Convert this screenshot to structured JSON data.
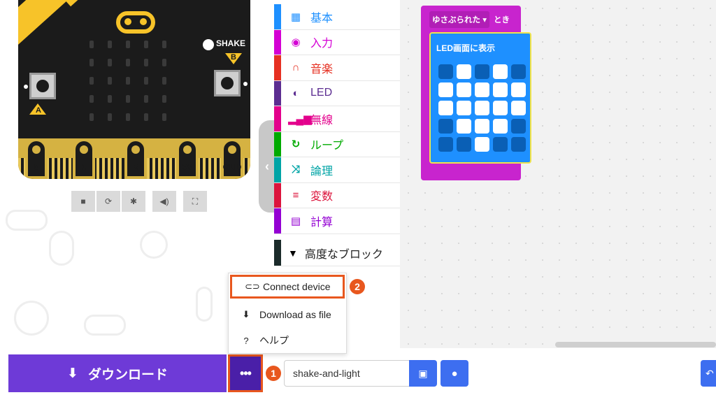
{
  "simulator": {
    "shake_label": "SHAKE",
    "button_a_label": "A",
    "button_b_label": "B",
    "pins": [
      "0",
      "1",
      "2",
      "3V",
      "GND"
    ],
    "toolbar_icons": [
      "stop-icon",
      "restart-icon",
      "debug-icon",
      "mute-icon",
      "fullscreen-icon"
    ]
  },
  "toolbox": {
    "categories": [
      {
        "label": "基本",
        "icon": "grid-icon",
        "color": "#1e90ff"
      },
      {
        "label": "入力",
        "icon": "target-icon",
        "color": "#d400d4"
      },
      {
        "label": "音楽",
        "icon": "headphones-icon",
        "color": "#e63022"
      },
      {
        "label": "LED",
        "icon": "toggle-icon",
        "color": "#5c2d91"
      },
      {
        "label": "無線",
        "icon": "signal-bars-icon",
        "color": "#e3008c"
      },
      {
        "label": "ループ",
        "icon": "refresh-icon",
        "color": "#00aa00"
      },
      {
        "label": "論理",
        "icon": "shuffle-icon",
        "color": "#00a4a6"
      },
      {
        "label": "変数",
        "icon": "lines-icon",
        "color": "#dc143c"
      },
      {
        "label": "計算",
        "icon": "calculator-icon",
        "color": "#9400d3"
      }
    ],
    "advanced_label": "高度なブロック"
  },
  "workspace": {
    "event_block": {
      "dropdown_label": "ゆさぶられた",
      "suffix": "とき",
      "color": "#c824ce"
    },
    "show_block": {
      "label": "LED画面に表示",
      "color": "#1e90ff",
      "leds": [
        [
          0,
          1,
          0,
          1,
          0
        ],
        [
          1,
          1,
          1,
          1,
          1
        ],
        [
          1,
          1,
          1,
          1,
          1
        ],
        [
          0,
          1,
          1,
          1,
          0
        ],
        [
          0,
          0,
          1,
          0,
          0
        ]
      ]
    }
  },
  "bottom_bar": {
    "download_label": "ダウンロード",
    "project_name": "shake-and-light",
    "more_label": "•••"
  },
  "menu": {
    "items": [
      {
        "label": "Connect device",
        "icon": "link-icon"
      },
      {
        "label": "Download as file",
        "icon": "download-file-icon"
      },
      {
        "label": "ヘルプ",
        "icon": "help-icon"
      }
    ]
  },
  "annotations": {
    "step1": "1",
    "step2": "2"
  }
}
